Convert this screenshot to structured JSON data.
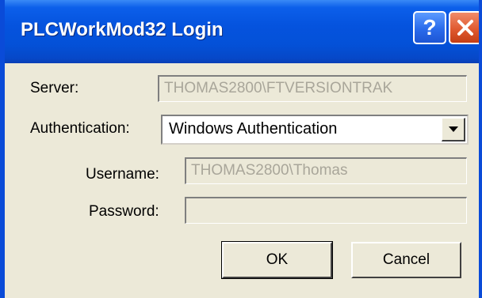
{
  "window": {
    "title": "PLCWorkMod32 Login"
  },
  "title_buttons": {
    "help_glyph": "?",
    "help_icon": "question-mark-icon",
    "close_icon": "close-x-icon"
  },
  "form": {
    "server_label": "Server:",
    "server_value": "THOMAS2800\\FTVERSIONTRAK",
    "auth_label": "Authentication:",
    "auth_value": "Windows Authentication",
    "auth_arrow_icon": "dropdown-arrow-icon",
    "username_label": "Username:",
    "username_value": "THOMAS2800\\Thomas",
    "password_label": "Password:",
    "password_value": ""
  },
  "buttons": {
    "ok_label": "OK",
    "cancel_label": "Cancel"
  },
  "colors": {
    "titlebar_blue": "#0553DE",
    "dialog_face": "#ECE9D8",
    "close_red": "#E05A30",
    "disabled_text": "#A9A69A"
  }
}
